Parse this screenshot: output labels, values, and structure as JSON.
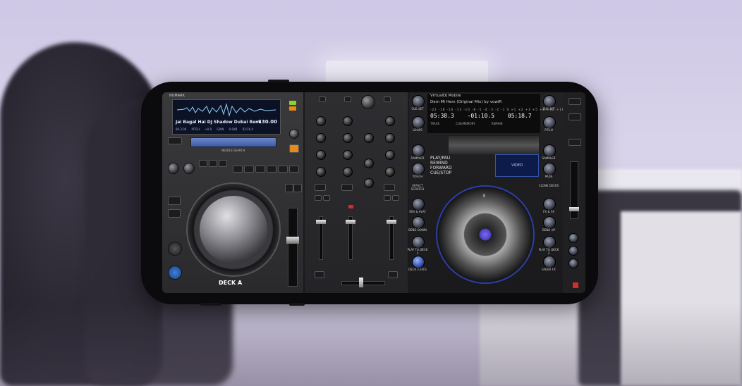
{
  "deck_a": {
    "brand": "NUMARK",
    "track_title": "Jai Bagal Hai DJ Shadow Dubai Remi",
    "bpm": "130.00",
    "info": "80.3.00 PITCH +0.0 GAIN 0.0dB 02:26.4",
    "search_label": "NEEDLE SEARCH",
    "label": "DECK A"
  },
  "deck_b": {
    "title": "VirtualDJ Mobile",
    "track": "Dem Mi Hem (Original Mix) by vowiR",
    "ticks": "-22 -18 -16 -13 -10 -8 -5 -4 -3 -2 -1 0 +1 +2 +3 +5 +8 +12 +16 +22",
    "times": "05:38.3  -01:10.5  05:18.7",
    "time_labels": "TRACK  CUE/MEMORY  REMAIN",
    "playlist": [
      "PLAY/PAU",
      "REWIND",
      "FORWARD",
      "CUE/STOP"
    ],
    "video_label": "VIDEO",
    "platter_number": "3",
    "left_buttons": [
      "CUE SET",
      "LOOPS",
      "SAMPLER",
      "TOUCH",
      "EFFECT SCRATCH",
      "REV & PLAY",
      "BEND DOWN",
      "PLAY TO DECK 3",
      "DECK 2 EFFS"
    ],
    "right_buttons": [
      "CUE SET",
      "PITCH",
      "SAMPLER",
      "PADS",
      "CLONE DECKS",
      "FX & FX",
      "BEND UP",
      "PLAY TO DECK 2",
      "FADER FX"
    ]
  },
  "colors": {
    "accent": "#3e82d8",
    "led_green": "#8dd22a",
    "led_orange": "#e88a1a",
    "led_red": "#d42b2b"
  }
}
